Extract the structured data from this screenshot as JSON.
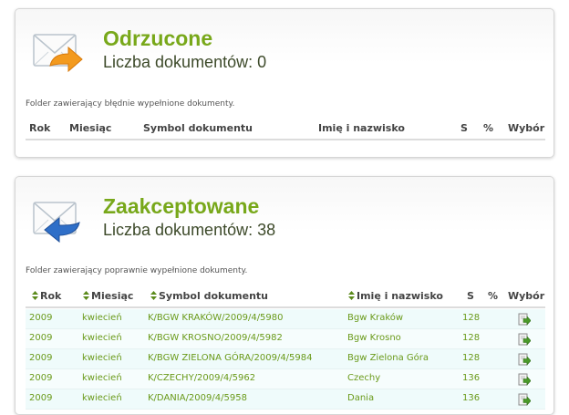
{
  "rejected": {
    "title": "Odrzucone",
    "count_text": "Liczba dokumentów: 0",
    "description": "Folder zawierający błędnie wypełnione dokumenty.",
    "icon": "envelope-arrow-orange-icon",
    "accent": "#f39a1e"
  },
  "accepted": {
    "title": "Zaakceptowane",
    "count_text": "Liczba dokumentów: 38",
    "description": "Folder zawierający poprawnie wypełnione dokumenty.",
    "icon": "envelope-arrow-blue-icon",
    "accent": "#2f6fc8"
  },
  "columns": {
    "year": "Rok",
    "month": "Miesiąc",
    "symbol": "Symbol dokumentu",
    "name": "Imię i nazwisko",
    "s": "S",
    "percent": "%",
    "select": "Wybór"
  },
  "colors": {
    "title_green": "#78a81a",
    "row_text_green": "#6a9a1a",
    "row_background": "#effbfb"
  },
  "documents": [
    {
      "year": "2009",
      "month": "kwiecień",
      "symbol": "K/BGW KRAKÓW/2009/4/5980",
      "name": "Bgw Kraków",
      "s": "128",
      "percent": ""
    },
    {
      "year": "2009",
      "month": "kwiecień",
      "symbol": "K/BGW KROSNO/2009/4/5982",
      "name": "Bgw Krosno",
      "s": "128",
      "percent": ""
    },
    {
      "year": "2009",
      "month": "kwiecień",
      "symbol": "K/BGW ZIELONA GÓRA/2009/4/5984",
      "name": "Bgw Zielona Góra",
      "s": "128",
      "percent": ""
    },
    {
      "year": "2009",
      "month": "kwiecień",
      "symbol": "K/CZECHY/2009/4/5962",
      "name": "Czechy",
      "s": "136",
      "percent": ""
    },
    {
      "year": "2009",
      "month": "kwiecień",
      "symbol": "K/DANIA/2009/4/5958",
      "name": "Dania",
      "s": "136",
      "percent": ""
    }
  ]
}
